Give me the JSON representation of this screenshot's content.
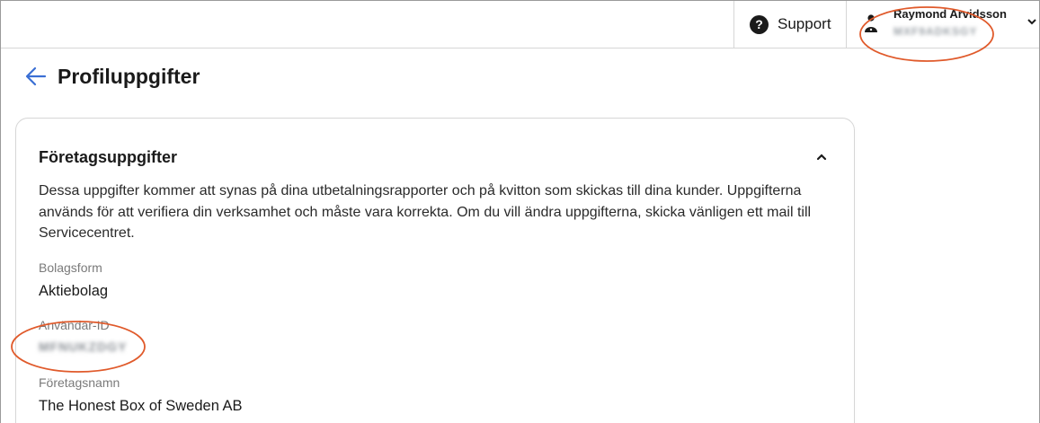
{
  "header": {
    "support_label": "Support",
    "support_icon": "question-circle-icon",
    "user": {
      "name": "Raymond Arvidsson",
      "sub_id_blurred": "MXF9ADKSGY",
      "icon": "person-icon",
      "menu_icon": "chevron-down-icon"
    }
  },
  "page": {
    "back_icon": "arrow-left-icon",
    "title": "Profiluppgifter"
  },
  "card": {
    "title": "Företagsuppgifter",
    "collapse_icon": "chevron-up-icon",
    "description": "Dessa uppgifter kommer att synas på dina utbetalningsrapporter och på kvitton som skickas till dina kunder. Uppgifterna används för att verifiera din verksamhet och måste vara korrekta. Om du vill ändra uppgifterna, skicka vänligen ett mail till Servicecentret.",
    "fields": [
      {
        "label": "Bolagsform",
        "value": "Aktiebolag"
      },
      {
        "label": "Användar-ID",
        "value": "MFNUKZDGY"
      },
      {
        "label": "Företagsnamn",
        "value": "The Honest Box of Sweden AB"
      }
    ]
  },
  "colors": {
    "accent": "#3b6fd4",
    "annotation": "#e05a2b",
    "border": "#d6d6d6"
  }
}
